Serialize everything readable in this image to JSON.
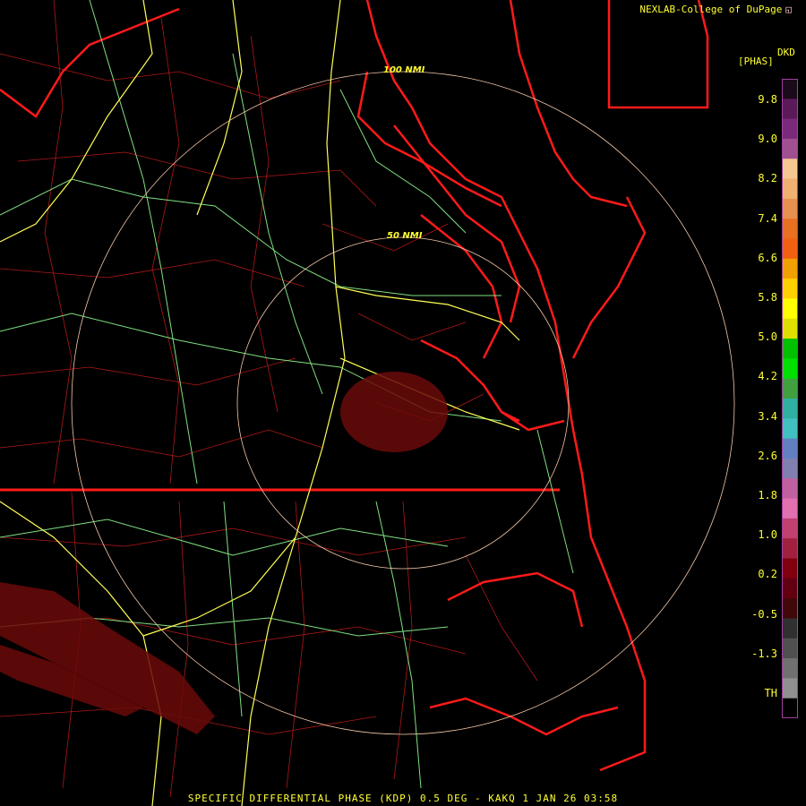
{
  "credit": {
    "text": "NEXLAB-College of DuPage",
    "logo_icon": "cod-logo-icon"
  },
  "legend": {
    "units": "[PHAS]",
    "product": "DKD",
    "ticks": [
      "9.8",
      "9.0",
      "8.2",
      "7.4",
      "6.6",
      "5.8",
      "5.0",
      "4.2",
      "3.4",
      "2.6",
      "1.8",
      "1.0",
      "0.2",
      "-0.5",
      "-1.3",
      "TH"
    ],
    "colors": [
      "#1a0a1a",
      "#5a1a5a",
      "#7a2a7a",
      "#a05090",
      "#f4c890",
      "#f0b070",
      "#e89050",
      "#e87020",
      "#f06010",
      "#f0a000",
      "#ffd000",
      "#ffff00",
      "#e0e000",
      "#00c000",
      "#00e000",
      "#40a040",
      "#30b0a0",
      "#40c0c0",
      "#6080c0",
      "#8080b0",
      "#c060a0",
      "#e070b0",
      "#c04070",
      "#a02040",
      "#800010",
      "#600010",
      "#400808",
      "#303030",
      "#505050",
      "#707070",
      "#909090",
      "#000000"
    ]
  },
  "rings": [
    {
      "label": "100 NMI"
    },
    {
      "label": "50 NMI"
    }
  ],
  "footer": "SPECIFIC DIFFERENTIAL PHASE (KDP) 0.5 DEG - KAKQ 1 JAN 26 03:58",
  "map_colors": {
    "coast": "#ff1a1a",
    "county": "#b01818",
    "highway": "#ffff55",
    "road": "#7fe080",
    "ring": "#f5c8a8",
    "echo": "#6a0a0a"
  }
}
